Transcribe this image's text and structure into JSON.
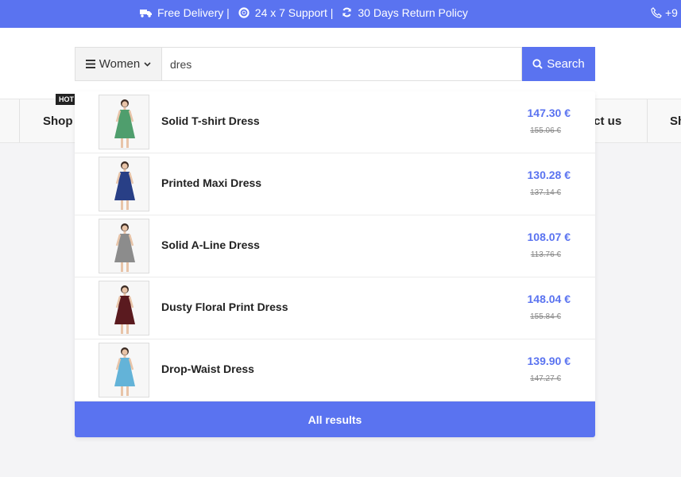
{
  "topbar": {
    "free_delivery": "Free Delivery |",
    "support": "24 x 7 Support |",
    "returns": "30 Days Return Policy",
    "phone": "+9",
    "icons": [
      "truck-icon",
      "lifebuoy-icon",
      "refresh-icon",
      "phone-icon"
    ]
  },
  "search": {
    "category_label": "Women",
    "query": "dres",
    "button_label": "Search"
  },
  "nav": {
    "hot_badge": "HOT",
    "shop_label": "Shop",
    "contact_partial": "uct us",
    "right_partial": "Sh"
  },
  "results": [
    {
      "name": "Solid T-shirt Dress",
      "price": "147.30 €",
      "old_price": "155.06 €",
      "dress_color": "#4f9e6d"
    },
    {
      "name": "Printed Maxi Dress",
      "price": "130.28 €",
      "old_price": "137.14 €",
      "dress_color": "#283f86"
    },
    {
      "name": "Solid A-Line Dress",
      "price": "108.07 €",
      "old_price": "113.76 €",
      "dress_color": "#8c8c8c"
    },
    {
      "name": "Dusty Floral Print Dress",
      "price": "148.04 €",
      "old_price": "155.84 €",
      "dress_color": "#5a1a1f"
    },
    {
      "name": "Drop-Waist Dress",
      "price": "139.90 €",
      "old_price": "147.27 €",
      "dress_color": "#63b3d8"
    }
  ],
  "all_results_label": "All results",
  "colors": {
    "accent": "#5a73f0",
    "text": "#222222"
  }
}
